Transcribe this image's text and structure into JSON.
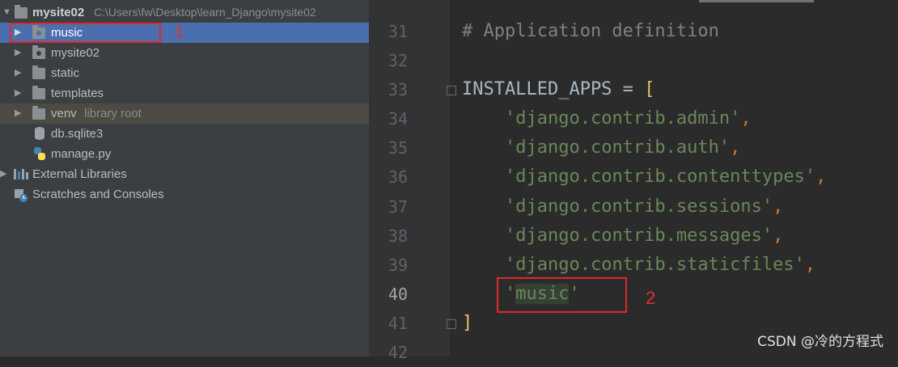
{
  "project_tree": {
    "root": {
      "name": "mysite02",
      "path": "C:\\Users\\fw\\Desktop\\learn_Django\\mysite02"
    },
    "items": [
      {
        "label": "music",
        "icon": "package-folder-icon"
      },
      {
        "label": "mysite02",
        "icon": "package-folder-icon"
      },
      {
        "label": "static",
        "icon": "folder-icon"
      },
      {
        "label": "templates",
        "icon": "folder-icon"
      },
      {
        "label": "venv",
        "suffix": "library root",
        "icon": "folder-icon"
      },
      {
        "label": "db.sqlite3",
        "icon": "database-file-icon"
      },
      {
        "label": "manage.py",
        "icon": "python-file-icon"
      },
      {
        "label": "External Libraries",
        "icon": "libraries-icon"
      },
      {
        "label": "Scratches and Consoles",
        "icon": "scratches-icon"
      }
    ]
  },
  "annotations": {
    "first": "1",
    "second": "2"
  },
  "editor": {
    "line_numbers": [
      "31",
      "32",
      "33",
      "34",
      "35",
      "36",
      "37",
      "38",
      "39",
      "40",
      "41",
      "42"
    ],
    "comment": "# Application definition",
    "var_name": "INSTALLED_APPS",
    "assign": " = ",
    "open_bracket": "[",
    "close_bracket": "]",
    "apps": [
      "django.contrib.admin",
      "django.contrib.auth",
      "django.contrib.contenttypes",
      "django.contrib.sessions",
      "django.contrib.messages",
      "django.contrib.staticfiles",
      "music"
    ],
    "quote": "'",
    "comma": ","
  },
  "watermark": "CSDN @冷的方程式",
  "colors": {
    "selection": "#4b6eaf",
    "string": "#6a8759",
    "keyword": "#cc7832",
    "bracket": "#e8bf6a",
    "annotation_red": "#e0272b"
  }
}
